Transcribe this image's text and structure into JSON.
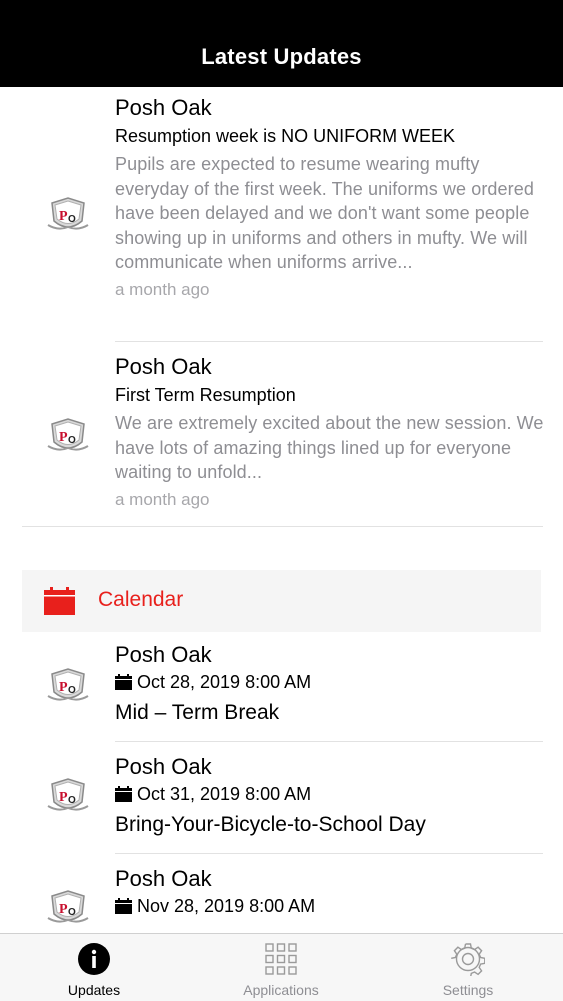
{
  "header": {
    "title": "Latest Updates"
  },
  "posts": [
    {
      "sender": "Posh Oak",
      "headline": "Resumption week is NO UNIFORM WEEK",
      "body": "Pupils are expected to resume wearing mufty everyday of the first week. The uniforms we ordered have been delayed and we don't want some people showing up in uniforms and others in mufty. We will communicate when uniforms arrive...",
      "time": "a month ago"
    },
    {
      "sender": "Posh Oak",
      "headline": "First Term Resumption",
      "body": "We are extremely excited about the new session. We have lots of amazing things lined up for everyone waiting to unfold...",
      "time": "a month ago"
    }
  ],
  "calendar": {
    "label": "Calendar",
    "accent": "#e8201c",
    "events": [
      {
        "sender": "Posh Oak",
        "date": "Oct 28, 2019 8:00 AM",
        "title": "Mid – Term Break"
      },
      {
        "sender": "Posh Oak",
        "date": "Oct 31, 2019 8:00 AM",
        "title": "Bring-Your-Bicycle-to-School Day"
      },
      {
        "sender": "Posh Oak",
        "date": "Nov 28, 2019 8:00 AM",
        "title": ""
      }
    ]
  },
  "tabs": [
    {
      "label": "Updates",
      "icon": "info-icon",
      "active": true
    },
    {
      "label": "Applications",
      "icon": "grid-icon",
      "active": false
    },
    {
      "label": "Settings",
      "icon": "gear-icon",
      "active": false
    }
  ]
}
